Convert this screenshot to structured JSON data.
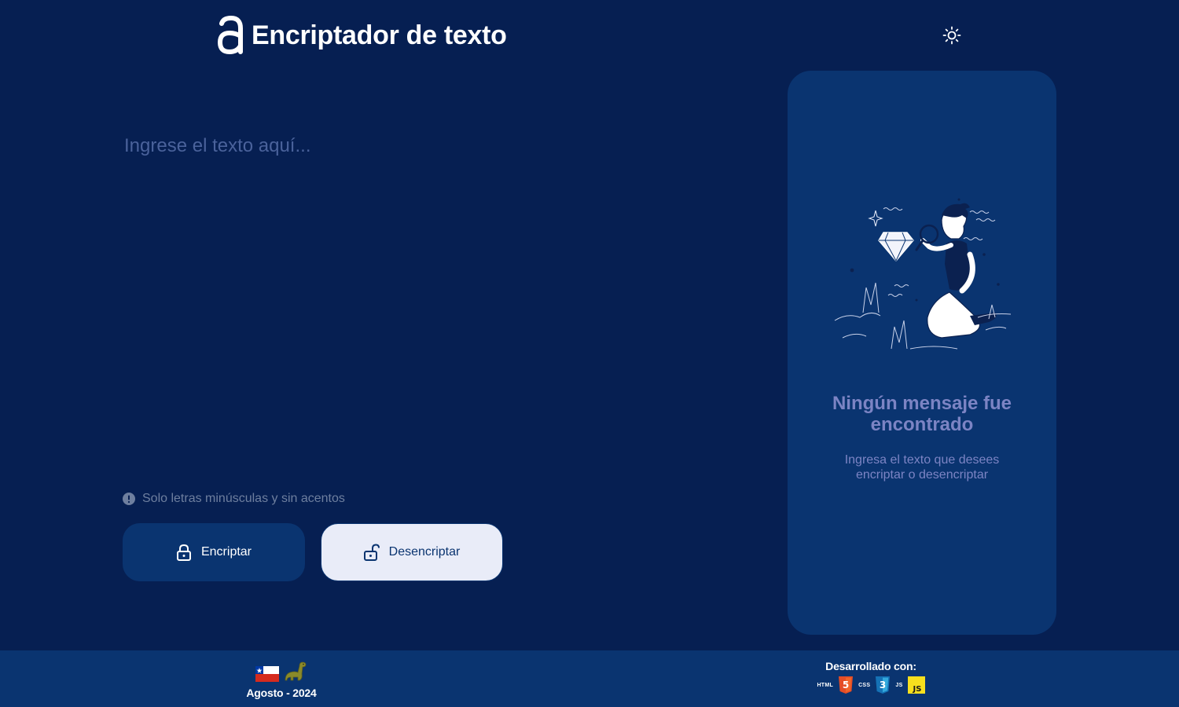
{
  "header": {
    "title": "Encriptador de texto",
    "logo_icon": "alura-a-logo-icon",
    "theme_toggle_icon": "sun-icon"
  },
  "editor": {
    "placeholder": "Ingrese el texto aquí...",
    "value": ""
  },
  "hint": {
    "icon": "info-icon",
    "text": "Solo letras minúsculas y sin acentos"
  },
  "buttons": {
    "encrypt_label": "Encriptar",
    "encrypt_icon": "lock-icon",
    "decrypt_label": "Desencriptar",
    "decrypt_icon": "unlock-icon"
  },
  "output": {
    "illustration": "person-with-magnifier-illustration",
    "title": "Ningún mensaje fue encontrado",
    "description": "Ingresa el texto que desees encriptar o desencriptar"
  },
  "footer": {
    "date": "Agosto - 2024",
    "icons": [
      "chile-flag-icon",
      "dinosaur-icon"
    ],
    "developed_with": "Desarrollado con:",
    "technologies": [
      {
        "name": "HTML",
        "icon": "html5-icon",
        "color": "#e44d26",
        "badge": "5"
      },
      {
        "name": "CSS",
        "icon": "css3-icon",
        "color": "#1572b6",
        "badge": "3"
      },
      {
        "name": "JS",
        "icon": "javascript-icon",
        "color": "#f7df1e",
        "badge": "JS"
      }
    ]
  },
  "colors": {
    "background": "#061f52",
    "panel": "#0a3470",
    "accent_text": "#7c84c4",
    "button_light": "#e9ecf8"
  }
}
